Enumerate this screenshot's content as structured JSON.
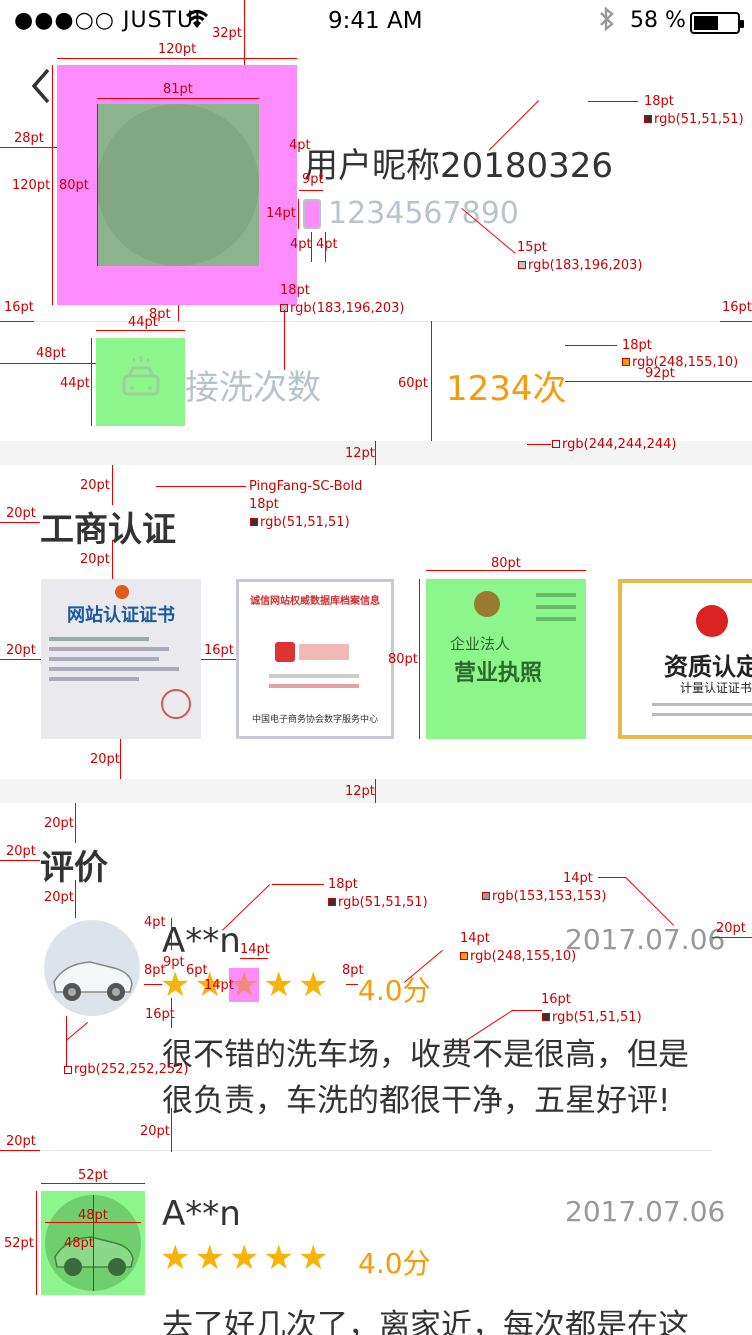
{
  "status_bar": {
    "carrier": "●●●○○ JUSTUI",
    "time": "9:41 AM",
    "battery_text": "58 %"
  },
  "profile": {
    "nickname": "用户昵称20180326",
    "phone": "1234567890"
  },
  "wash": {
    "label": "接洗次数",
    "count": "1234次"
  },
  "business": {
    "title": "工商认证",
    "cert1_title": "网站认证证书",
    "cert2_title": "诚信网站权威数据库档案信息",
    "cert2_footer": "中国电子商务协会数字服务中心",
    "cert3_line1": "企业法人",
    "cert3_line2": "营业执照",
    "cert4_line1": "资质认定",
    "cert4_line2": "计量认证证书"
  },
  "reviews": {
    "title": "评价",
    "items": [
      {
        "name": "A**n",
        "date": "2017.07.06",
        "score": "4.0分",
        "rating": 5,
        "line1": "很不错的洗车场，收费不是很高，但是",
        "line2": "很负责，车洗的都很干净，五星好评!"
      },
      {
        "name": "A**n",
        "date": "2017.07.06",
        "score": "4.0分",
        "rating": 5,
        "line1": "去了好几次了，离家近，每次都是在这"
      }
    ]
  },
  "annotations": {
    "a_32pt": "32pt",
    "a_120pt_top": "120pt",
    "a_81pt": "81pt",
    "a_28pt": "28pt",
    "a_120pt_left": "120pt",
    "a_80pt": "80pt",
    "a_4pt_a": "4pt",
    "a_9pt_a": "9pt",
    "a_14pt_a": "14pt",
    "a_4pt_b": "4pt",
    "a_4pt_c": "4pt",
    "a_18pt_name": "18pt",
    "a_rgb_name": "rgb(51,51,51)",
    "a_15pt": "15pt",
    "a_rgb_phone": "rgb(183,196,203)",
    "a_18pt_wash": "18pt",
    "a_rgb_wash": "rgb(183,196,203)",
    "a_16pt_l": "16pt",
    "a_16pt_r": "16pt",
    "a_8pt": "8pt",
    "a_44pt_top": "44pt",
    "a_48pt": "48pt",
    "a_44pt_left": "44pt",
    "a_60pt": "60pt",
    "a_18pt_count": "18pt",
    "a_rgb_count": "rgb(248,155,10)",
    "a_92pt": "92pt",
    "a_12pt_a": "12pt",
    "a_rgb_bg": "rgb(244,244,244)",
    "a_20pt_a": "20pt",
    "a_font": "PingFang-SC-Bold",
    "a_18pt_title": "18pt",
    "a_rgb_title": "rgb(51,51,51)",
    "a_20pt_b": "20pt",
    "a_20pt_c": "20pt",
    "a_80pt_cert": "80pt",
    "a_20pt_d": "20pt",
    "a_16pt_gap": "16pt",
    "a_80pt_h": "80pt",
    "a_20pt_e": "20pt",
    "a_12pt_b": "12pt",
    "a_20pt_f": "20pt",
    "a_20pt_g": "20pt",
    "a_20pt_h": "20pt",
    "a_18pt_rname": "18pt",
    "a_rgb_rname": "rgb(51,51,51)",
    "a_14pt_date": "14pt",
    "a_rgb_date": "rgb(153,153,153)",
    "a_20pt_right": "20pt",
    "a_4pt_d": "4pt",
    "a_14pt_star": "14pt",
    "a_14pt_score": "14pt",
    "a_rgb_score": "rgb(248,155,10)",
    "a_9pt_b": "9pt",
    "a_8pt_a": "8pt",
    "a_6pt": "6pt",
    "a_14pt_b": "14pt",
    "a_8pt_b": "8pt",
    "a_16pt_text": "16pt",
    "a_rgb_text": "rgb(51,51,51)",
    "a_16pt_c": "16pt",
    "a_rgb_avatar": "rgb(252,252,252)",
    "a_20pt_i": "20pt",
    "a_20pt_j": "20pt",
    "a_52pt_top": "52pt",
    "a_48pt_a": "48pt",
    "a_52pt_left": "52pt",
    "a_48pt_b": "48pt"
  },
  "colors": {
    "name": "#333333",
    "phone": "#b7c4cb",
    "accent": "#f89b0a",
    "date": "#999999",
    "bg": "#f4f4f4",
    "highlight_magenta": "#ff8cff",
    "highlight_green": "#8cf58c"
  }
}
